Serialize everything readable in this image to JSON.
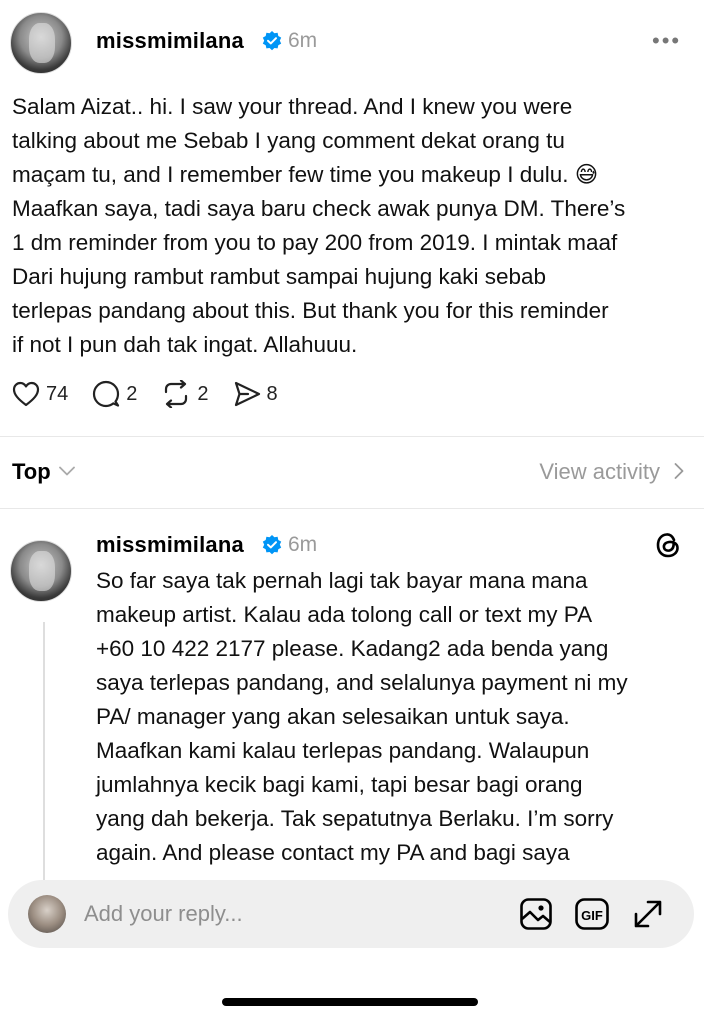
{
  "post": {
    "username": "missmimilana",
    "time": "6m",
    "more_label": "•••",
    "lines": [
      "Salam Aizat.. hi. I saw your thread. And I knew you were",
      "talking about me Sebab I yang comment dekat orang tu",
      "maçam tu, and I remember few time you makeup I dulu. 😅",
      "Maafkan saya, tadi saya baru check awak punya DM. There’s",
      "1 dm reminder from you to pay 200 from 2019. I mintak maaf",
      "Dari hujung rambut rambut sampai hujung kaki sebab",
      "terlepas pandang about this. But thank you for this reminder",
      "if not I pun dah tak ingat. Allahuuu."
    ],
    "likes": "74",
    "comments": "2",
    "reposts": "2",
    "shares": "8"
  },
  "sort": {
    "label": "Top",
    "view_activity": "View activity"
  },
  "reply": {
    "username": "missmimilana",
    "time": "6m",
    "lines": [
      "So far saya tak pernah lagi tak bayar mana mana",
      "makeup artist. Kalau ada tolong call or text my PA",
      "+60 10 422 2177 please. Kadang2 ada benda yang",
      "saya terlepas pandang, and selalunya payment ni my",
      "PA/ manager yang akan selesaikan untuk saya.",
      "Maafkan kami kalau terlepas pandang. Walaupun",
      "jumlahnya kecik bagi kami, tapi besar bagi orang",
      "yang dah bekerja. Tak sepatutnya Berlaku. I’m sorry",
      "again. And please contact my PA and bagi saya"
    ]
  },
  "composer": {
    "placeholder": "Add your reply..."
  },
  "colors": {
    "verified": "#0095f6",
    "muted": "#9a9a9a"
  },
  "icons": [
    "heart-icon",
    "comment-icon",
    "repost-icon",
    "share-icon",
    "chevron-down-icon",
    "chevron-right-icon",
    "threads-logo-icon",
    "image-icon",
    "gif-icon",
    "expand-icon"
  ]
}
